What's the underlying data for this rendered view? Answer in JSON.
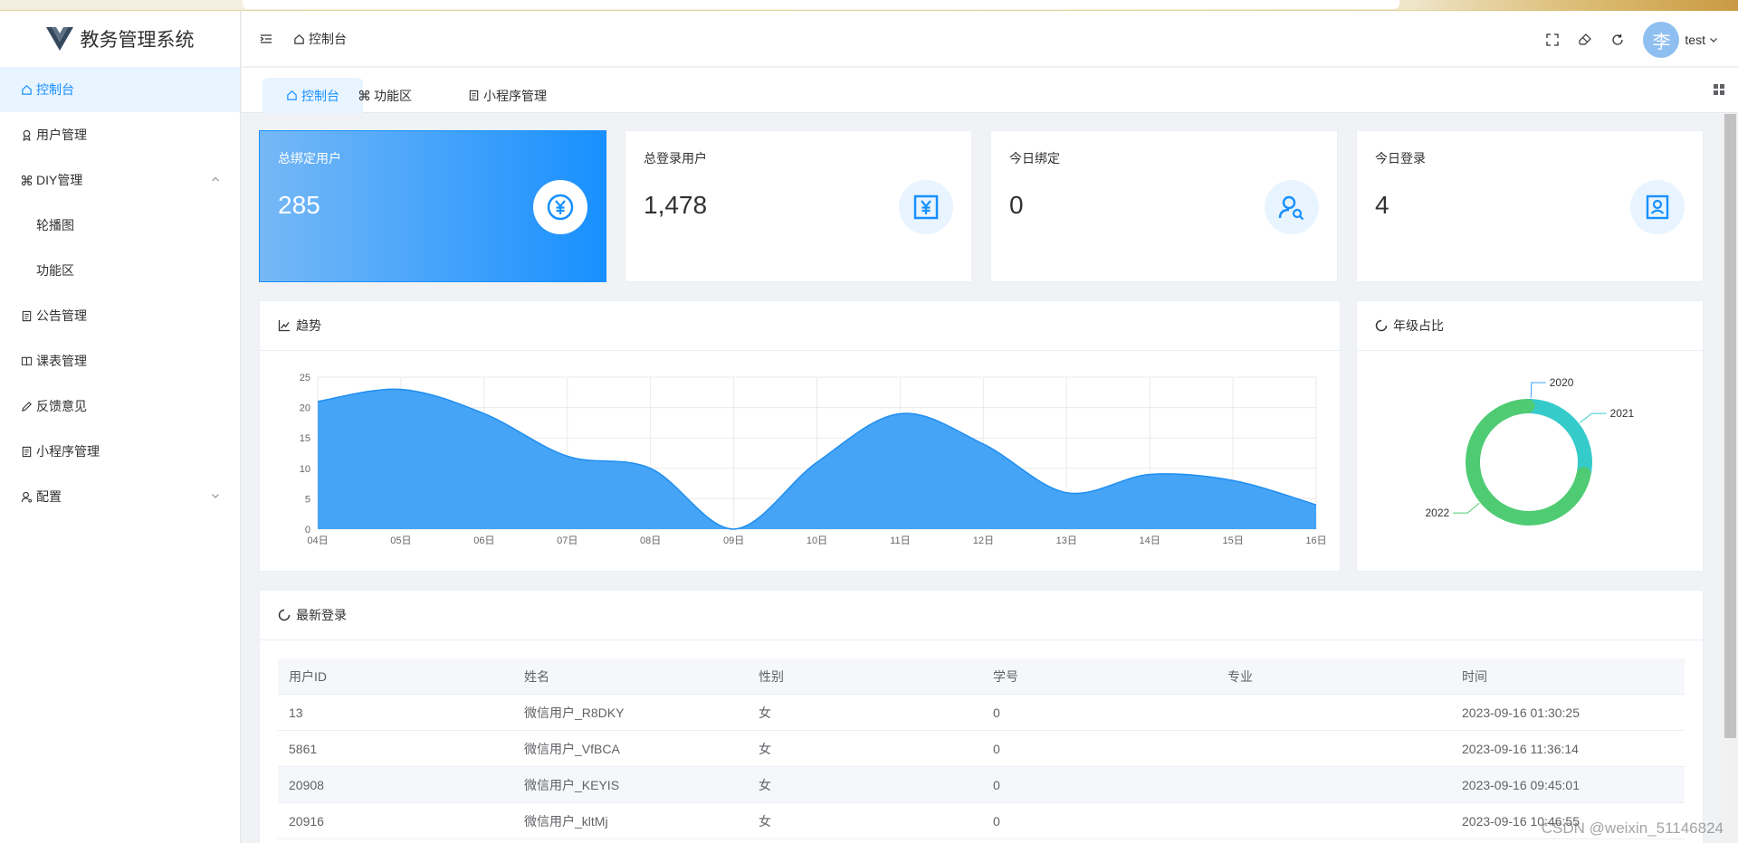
{
  "app": {
    "title": "教务管理系统"
  },
  "sidebar": {
    "items": [
      {
        "label": "控制台",
        "icon": "home-icon",
        "active": true
      },
      {
        "label": "用户管理",
        "icon": "user-badge-icon"
      },
      {
        "label": "DIY管理",
        "icon": "command-icon",
        "expanded": true
      },
      {
        "label": "轮播图",
        "sub": true
      },
      {
        "label": "功能区",
        "sub": true
      },
      {
        "label": "公告管理",
        "icon": "document-icon"
      },
      {
        "label": "课表管理",
        "icon": "book-icon"
      },
      {
        "label": "反馈意见",
        "icon": "pen-icon"
      },
      {
        "label": "小程序管理",
        "icon": "document-icon"
      },
      {
        "label": "配置",
        "icon": "user-settings-icon",
        "expanded": false
      }
    ]
  },
  "header": {
    "breadcrumb": "控制台",
    "avatar_text": "李",
    "username": "test"
  },
  "tabs": [
    {
      "label": "控制台",
      "icon": "home-icon",
      "active": true
    },
    {
      "label": "功能区",
      "icon": "command-icon"
    },
    {
      "label": "小程序管理",
      "icon": "document-icon"
    }
  ],
  "stats": [
    {
      "label": "总绑定用户",
      "value": "285",
      "icon": "yen-circle-icon",
      "highlight": true
    },
    {
      "label": "总登录用户",
      "value": "1,478",
      "icon": "yen-box-icon"
    },
    {
      "label": "今日绑定",
      "value": "0",
      "icon": "user-search-icon"
    },
    {
      "label": "今日登录",
      "value": "4",
      "icon": "user-card-icon"
    }
  ],
  "trend": {
    "title": "趋势"
  },
  "grade": {
    "title": "年级占比"
  },
  "chart_data": [
    {
      "type": "area",
      "title": "趋势",
      "x": [
        "04日",
        "05日",
        "06日",
        "07日",
        "08日",
        "09日",
        "10日",
        "11日",
        "12日",
        "13日",
        "14日",
        "15日",
        "16日"
      ],
      "values": [
        21,
        23,
        19,
        12,
        10,
        0,
        11,
        19,
        14,
        6,
        9,
        8,
        4
      ],
      "ylim": [
        0,
        25
      ],
      "yticks": [
        0,
        5,
        10,
        15,
        20,
        25
      ],
      "grid": true,
      "color": "#3c9ff7"
    },
    {
      "type": "pie",
      "title": "年级占比",
      "donut": true,
      "labels": [
        "2020",
        "2021",
        "2022"
      ],
      "values": [
        1,
        27,
        72
      ],
      "colors": [
        "#3aa1ff",
        "#36cbcb",
        "#4ecb73"
      ]
    }
  ],
  "latest": {
    "title": "最新登录",
    "columns": [
      "用户ID",
      "姓名",
      "性别",
      "学号",
      "专业",
      "时间"
    ],
    "rows": [
      [
        "13",
        "微信用户_R8DKY",
        "女",
        "0",
        "",
        "2023-09-16 01:30:25"
      ],
      [
        "5861",
        "微信用户_VfBCA",
        "女",
        "0",
        "",
        "2023-09-16 11:36:14"
      ],
      [
        "20908",
        "微信用户_KEYIS",
        "女",
        "0",
        "",
        "2023-09-16 09:45:01"
      ],
      [
        "20916",
        "微信用户_kltMj",
        "女",
        "0",
        "",
        "2023-09-16 10:46:55"
      ]
    ]
  },
  "watermark": "CSDN @weixin_51146824",
  "colors": {
    "accent": "#1890ff",
    "active_bg": "#e8f4ff"
  }
}
